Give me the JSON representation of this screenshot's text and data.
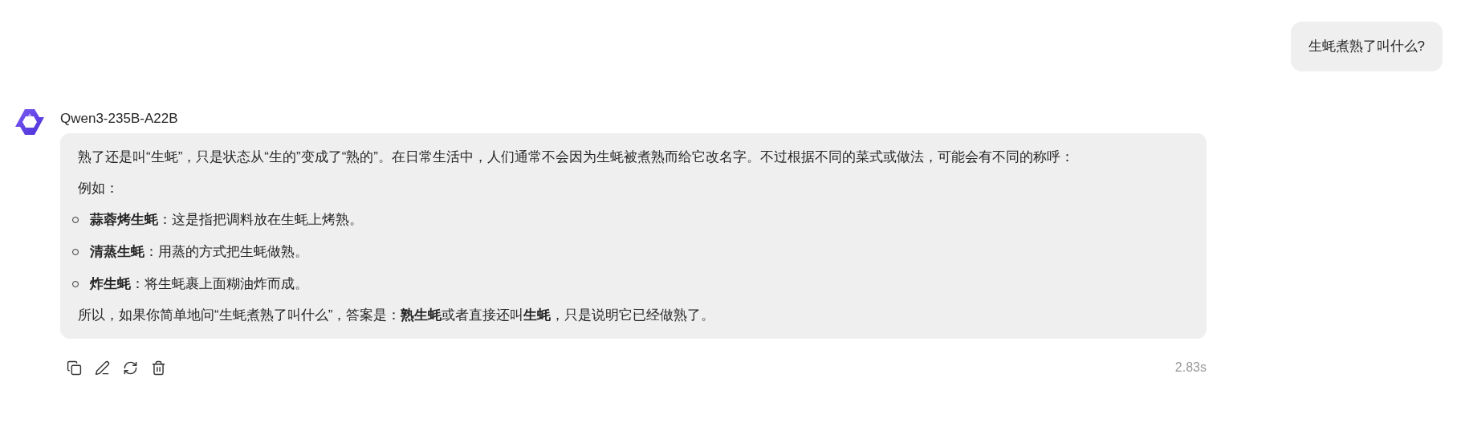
{
  "user_message": {
    "text": "生蚝煮熟了叫什么?"
  },
  "assistant": {
    "model_name": "Qwen3-235B-A22B",
    "blocks": [
      {
        "kind": "paragraph",
        "text": "熟了还是叫“生蚝”，只是状态从“生的”变成了“熟的”。在日常生活中，人们通常不会因为生蚝被煮熟而给它改名字。不过根据不同的菜式或做法，可能会有不同的称呼："
      },
      {
        "kind": "paragraph",
        "text": "例如："
      },
      {
        "kind": "list",
        "items": [
          "**蒜蓉烤生蚝**：这是指把调料放在生蚝上烤熟。",
          "**清蒸生蚝**：用蒸的方式把生蚝做熟。",
          "**炸生蚝**：将生蚝裹上面糊油炸而成。"
        ]
      },
      {
        "kind": "paragraph",
        "text": "所以，如果你简单地问“生蚝煮熟了叫什么”，答案是：**熟生蚝**或者直接还叫**生蚝**，只是说明它已经做熟了。"
      }
    ],
    "actions": [
      {
        "kind": "copy"
      },
      {
        "kind": "edit"
      },
      {
        "kind": "regenerate"
      },
      {
        "kind": "delete"
      }
    ],
    "duration": "2.83s"
  }
}
